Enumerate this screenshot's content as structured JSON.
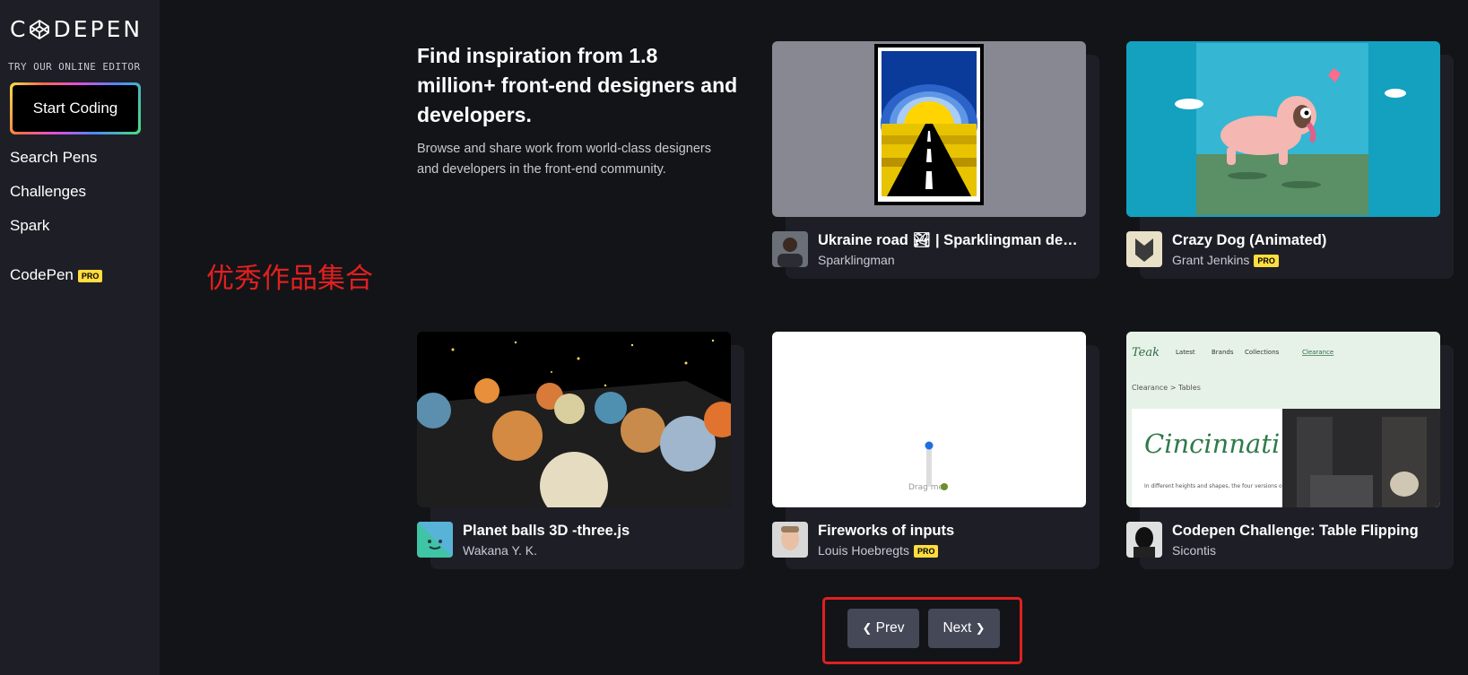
{
  "sidebar": {
    "logo_text_left": "C",
    "logo_text_right": "DEPEN",
    "try_label": "TRY OUR ONLINE EDITOR",
    "start_button": "Start Coding",
    "nav": [
      "Search Pens",
      "Challenges",
      "Spark"
    ],
    "codepen_label": "CodePen",
    "pro_badge": "PRO"
  },
  "annotation": "优秀作品集合",
  "hero": {
    "title": "Find inspiration from 1.8 million+ front-end designers and developers.",
    "description": "Browse and share work from world-class designers and developers in the front-end community."
  },
  "cards": [
    {
      "title": "Ukraine road 🏞 | Sparklingman design",
      "author": "Sparklingman",
      "pro": false
    },
    {
      "title": "Crazy Dog (Animated)",
      "author": "Grant Jenkins",
      "pro": true,
      "pro_label": "PRO"
    },
    {
      "title": "Planet balls 3D -three.js",
      "author": "Wakana Y. K.",
      "pro": false
    },
    {
      "title": "Fireworks of inputs",
      "author": "Louis Hoebregts",
      "pro": true,
      "pro_label": "PRO"
    },
    {
      "title": "Codepen Challenge: Table Flipping",
      "author": "Sicontis",
      "pro": false
    }
  ],
  "thumb_text": {
    "drag": "Drag me",
    "nav_logo": "Teak",
    "nav_links": [
      "Latest",
      "Brands",
      "Collections",
      "Clearance"
    ],
    "breadcrumb": "Clearance > Tables",
    "headline": "Cincinnati",
    "body": "In different heights and shapes, the four versions of Floema low tables offer a"
  },
  "pagination": {
    "prev": "Prev",
    "next": "Next"
  },
  "colors": {
    "pro_badge": "#ffdd40",
    "annotation": "#e02020",
    "sidebar_bg": "#1e1f26",
    "page_bg": "#131417"
  }
}
